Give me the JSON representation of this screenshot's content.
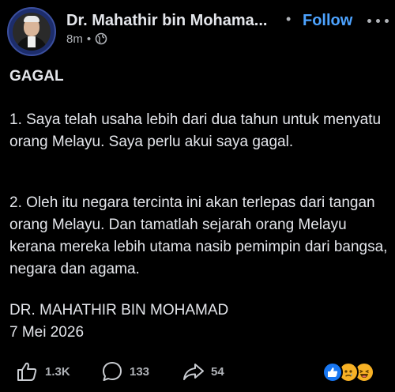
{
  "post": {
    "author": "Dr. Mahathir bin Mohama...",
    "follow_label": "Follow",
    "follow_separator": "•",
    "time": "8m",
    "meta_separator": "•",
    "title": "GAGAL",
    "paragraph_1": "1. Saya telah usaha lebih dari dua tahun untuk menyatu orang Melayu. Saya perlu akui saya gagal.",
    "paragraph_2": "2. Oleh itu negara tercinta ini akan terlepas dari tangan orang Melayu. Dan tamatlah sejarah orang Melayu kerana mereka lebih utama nasib pemimpin dari bangsa, negara dan agama.",
    "signature_name": "DR. MAHATHIR BIN MOHAMAD",
    "signature_date": "7 Mei 2026"
  },
  "actions": {
    "like_count": "1.3K",
    "comment_count": "133",
    "share_count": "54"
  },
  "icons": {
    "like": "thumbs-up-icon",
    "comment": "comment-bubble-icon",
    "share": "share-arrow-icon",
    "privacy": "globe-icon",
    "more": "more-dots-icon"
  },
  "colors": {
    "background": "#000000",
    "text": "#e4e6eb",
    "muted": "#b0b3b8",
    "follow": "#4da3ff"
  }
}
